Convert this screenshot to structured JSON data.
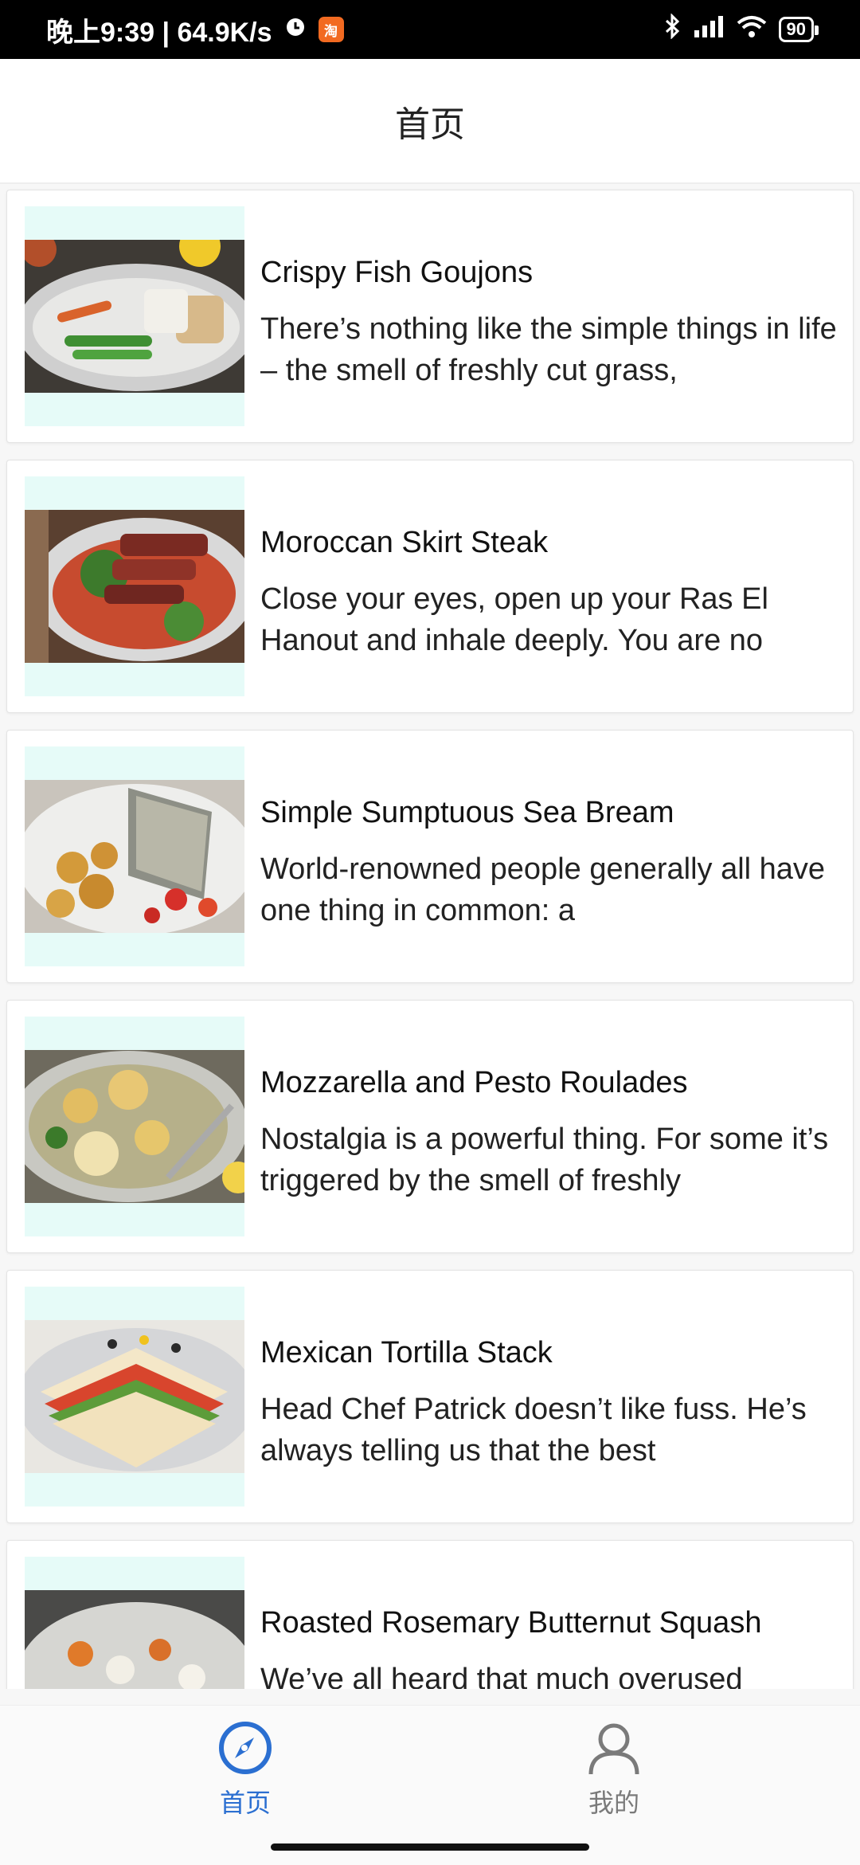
{
  "status_bar": {
    "time_speed": "晚上9:39 | 64.9K/s",
    "taobao_glyph": "淘",
    "battery": "90",
    "icons": [
      "alarm-icon",
      "taobao-app-icon",
      "bluetooth-icon",
      "signal-icon",
      "wifi-icon",
      "battery-icon"
    ]
  },
  "header": {
    "title": "首页"
  },
  "recipes": [
    {
      "title": "Crispy Fish Goujons",
      "description": "There’s nothing like the simple things in life – the smell of freshly cut grass,",
      "image": "fish-goujons-plate"
    },
    {
      "title": "Moroccan Skirt Steak",
      "description": "Close your eyes, open up your Ras El Hanout and inhale deeply. You are no",
      "image": "skirt-steak-plate"
    },
    {
      "title": "Simple Sumptuous Sea Bream",
      "description": "World-renowned people generally all have one thing in common: a",
      "image": "sea-bream-plate"
    },
    {
      "title": "Mozzarella and Pesto Roulades",
      "description": "Nostalgia is a powerful thing. For some it’s triggered by the smell of freshly",
      "image": "roulades-plate"
    },
    {
      "title": "Mexican Tortilla Stack",
      "description": "Head Chef Patrick doesn’t like fuss. He’s always telling us that the best",
      "image": "tortilla-stack-plate"
    },
    {
      "title": "Roasted Rosemary Butternut Squash",
      "description": "We’ve all heard that much overused",
      "image": "butternut-squash-plate"
    }
  ],
  "tabbar": {
    "home_label": "首页",
    "mine_label": "我的",
    "active_color": "#2b6fd1",
    "inactive_color": "#7a7a7a"
  }
}
